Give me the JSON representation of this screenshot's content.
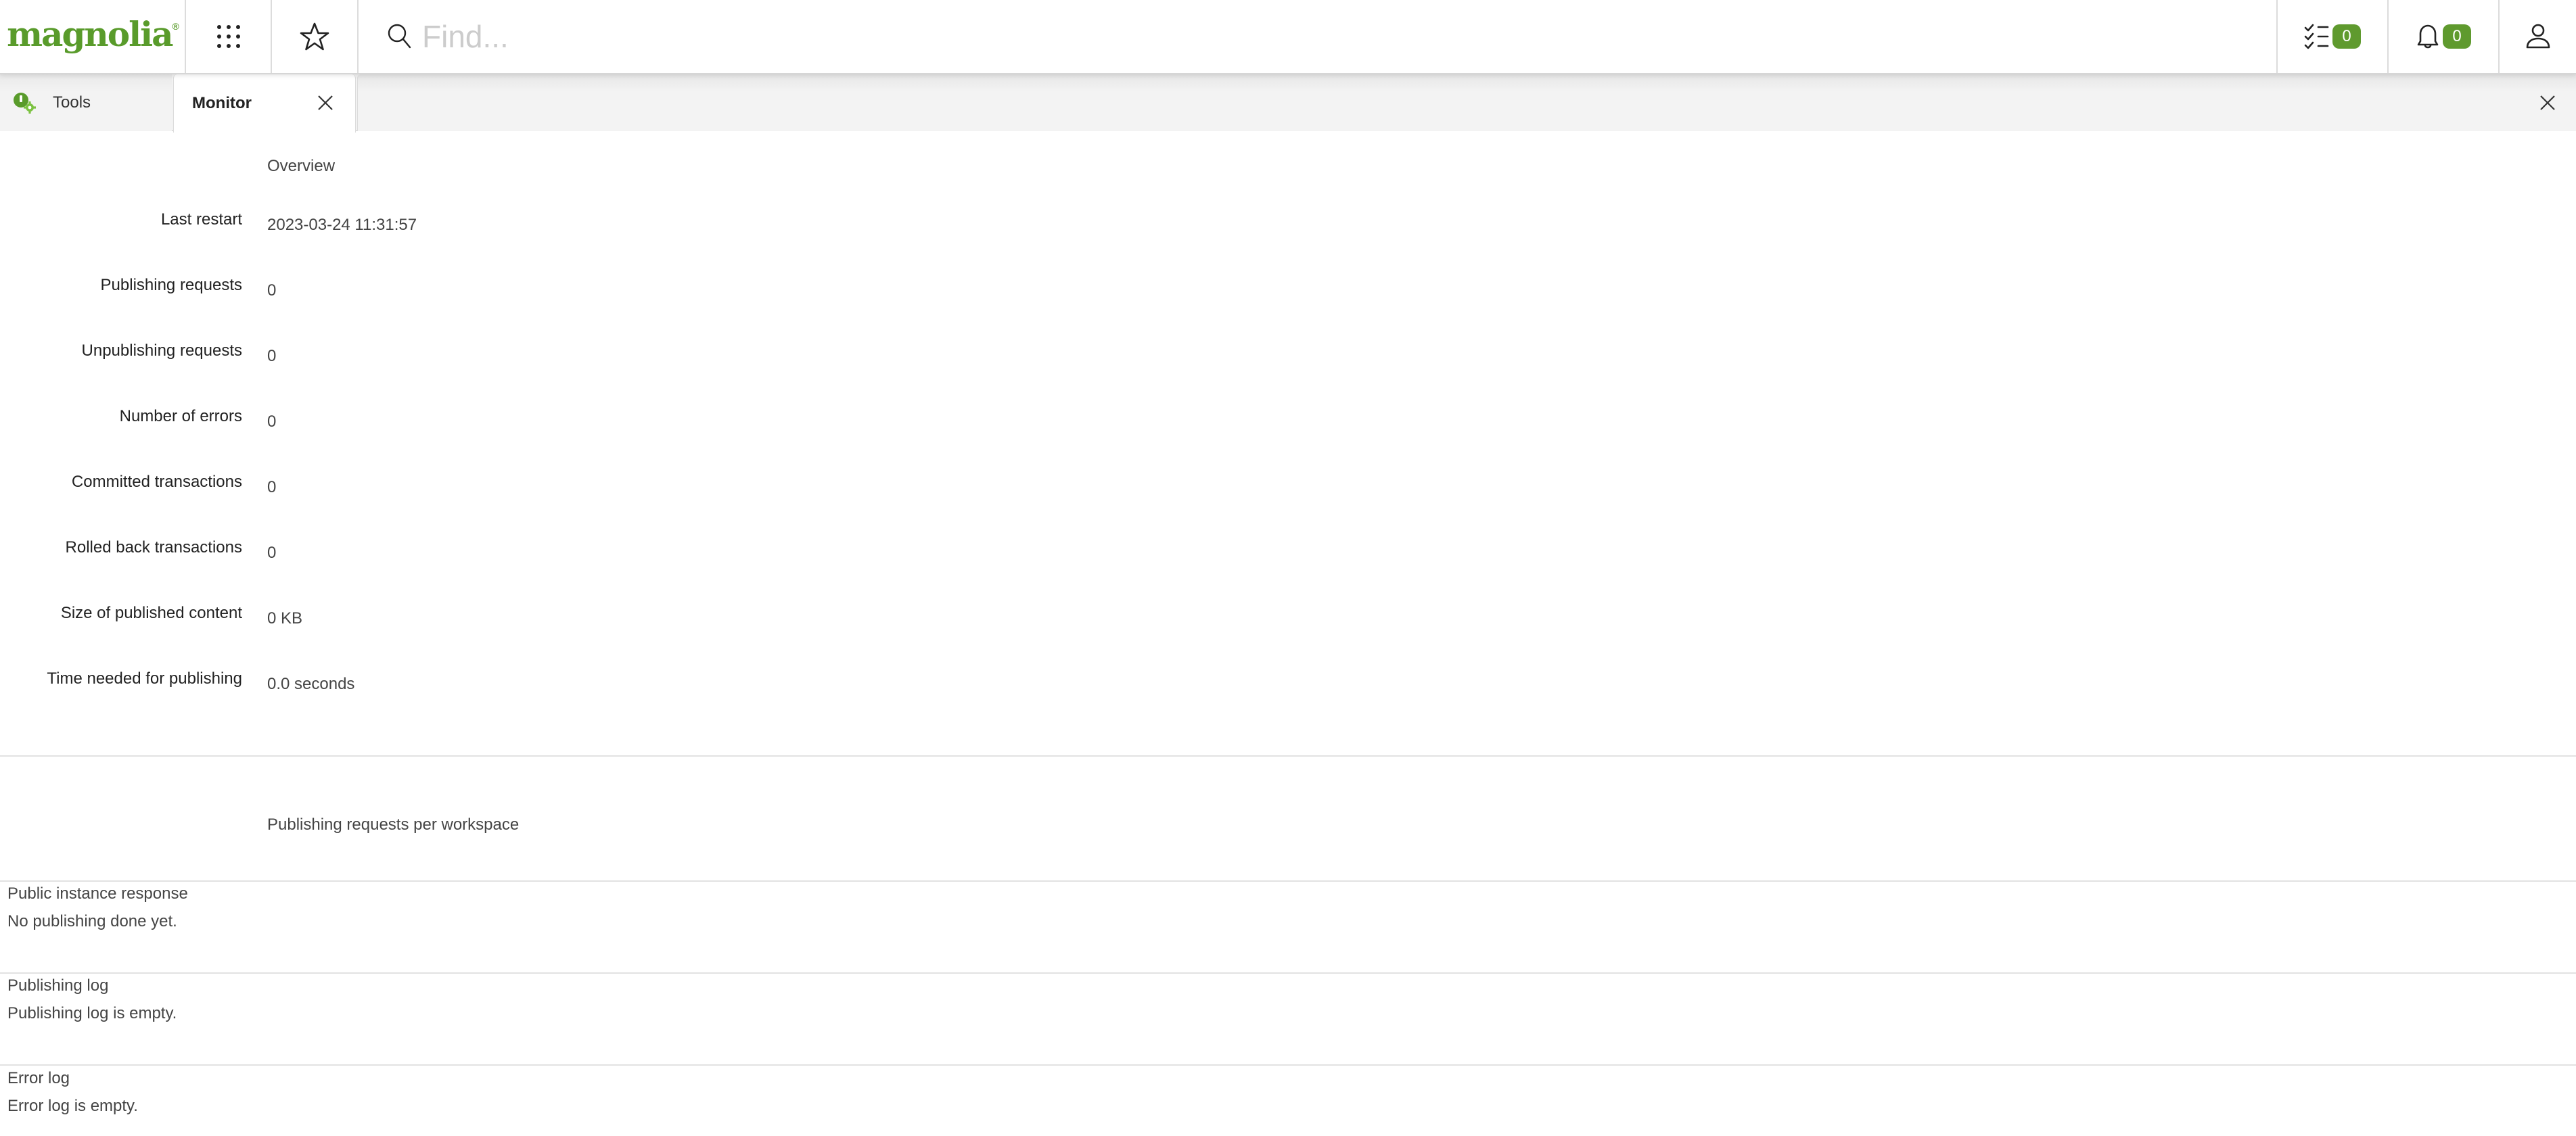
{
  "header": {
    "logo_text": "magnolia",
    "logo_mark": "®",
    "search_placeholder": "Find...",
    "search_value": "",
    "tasks_count": "0",
    "notifications_count": "0",
    "icons": {
      "apps": "grid-icon",
      "favorites": "star-icon",
      "search": "search-icon",
      "tasks": "tasks-checklist-icon",
      "notifications": "bell-icon",
      "user": "user-icon"
    }
  },
  "colors": {
    "brand_green": "#599b2b",
    "badge_green": "#5f9a2e"
  },
  "tabs": [
    {
      "label": "Tools",
      "icon": "tools-app-icon",
      "active": false
    },
    {
      "label": "Monitor",
      "active": true,
      "closable": true
    }
  ],
  "overview": {
    "title": "Overview",
    "rows": [
      {
        "label": "Last restart",
        "value": "2023-03-24 11:31:57"
      },
      {
        "label": "Publishing requests",
        "value": "0"
      },
      {
        "label": "Unpublishing requests",
        "value": "0"
      },
      {
        "label": "Number of errors",
        "value": "0"
      },
      {
        "label": "Committed transactions",
        "value": "0"
      },
      {
        "label": "Rolled back transactions",
        "value": "0"
      },
      {
        "label": "Size of published content",
        "value": "0 KB"
      },
      {
        "label": "Time needed for publishing",
        "value": "0.0 seconds"
      }
    ]
  },
  "workspace_section": {
    "title": "Publishing requests per workspace"
  },
  "panels": [
    {
      "title": "Public instance response",
      "text": "No publishing done yet."
    },
    {
      "title": "Publishing log",
      "text": "Publishing log is empty."
    },
    {
      "title": "Error log",
      "text": "Error log is empty."
    }
  ]
}
